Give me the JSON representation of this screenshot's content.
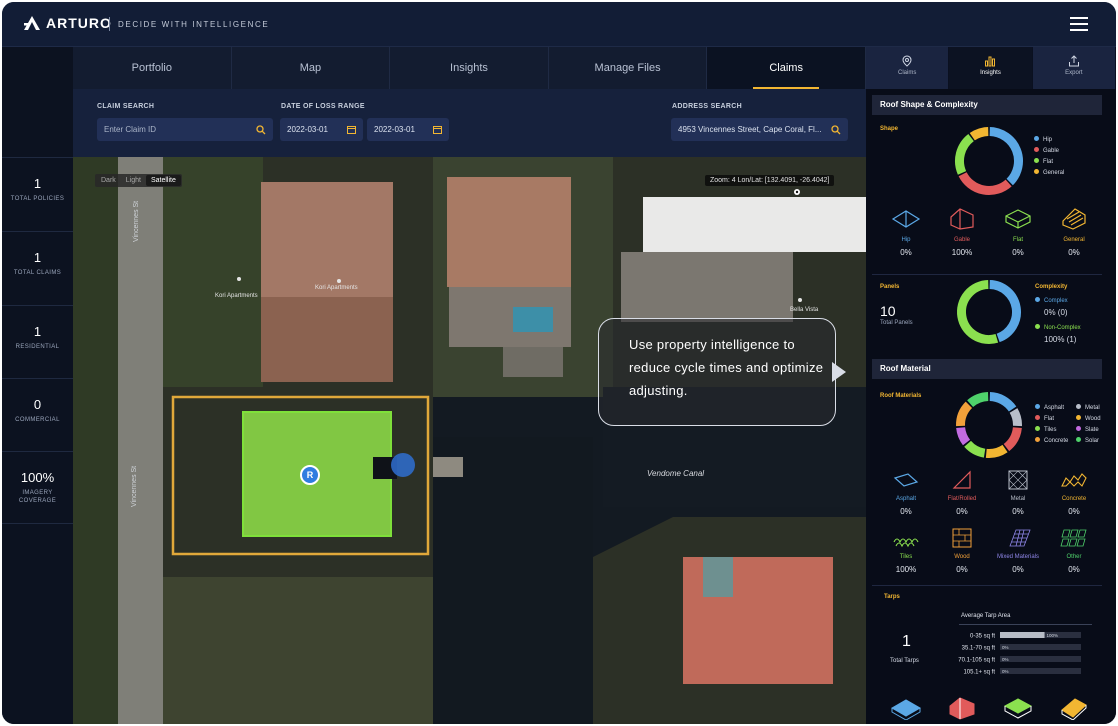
{
  "app": {
    "brand": "ARTURO",
    "tagline": "DECIDE WITH INTELLIGENCE"
  },
  "nav": {
    "tabs": [
      {
        "label": "Portfolio"
      },
      {
        "label": "Map"
      },
      {
        "label": "Insights"
      },
      {
        "label": "Manage Files"
      },
      {
        "label": "Claims",
        "active": true
      }
    ]
  },
  "stats": [
    {
      "value": "1",
      "label": "TOTAL POLICIES"
    },
    {
      "value": "1",
      "label": "TOTAL CLAIMS"
    },
    {
      "value": "1",
      "label": "RESIDENTIAL"
    },
    {
      "value": "0",
      "label": "COMMERCIAL"
    },
    {
      "value": "100%",
      "label": "IMAGERY COVERAGE"
    }
  ],
  "search": {
    "claim_label": "CLAIM SEARCH",
    "claim_placeholder": "Enter Claim ID",
    "date_label": "DATE OF LOSS RANGE",
    "date_from": "2022-03-01",
    "date_to": "2022-03-01",
    "address_label": "ADDRESS SEARCH",
    "address_value": "4953 Vincennes Street, Cape Coral, Fl..."
  },
  "map": {
    "styles": [
      {
        "label": "Dark"
      },
      {
        "label": "Light"
      },
      {
        "label": "Satellite",
        "active": true
      }
    ],
    "zoom_text": "Zoom: 4 Lon/Lat: [132.4091, -26.4042]",
    "callout": "Use property intelligence to reduce cycle times and optimize adjusting.",
    "canal_label": "Vendome Canal",
    "street_label_top": "Vincennes St",
    "street_label_bottom": "Vincennes St",
    "marker_label": "R",
    "pois": [
      {
        "label": "Kori Apartments"
      },
      {
        "label": "Kori Apartments"
      },
      {
        "label": "Bella Vista"
      }
    ]
  },
  "right_tabs": [
    {
      "label": "Claims",
      "icon": "map-pin-icon"
    },
    {
      "label": "Insights",
      "icon": "bar-chart-icon",
      "active": true
    },
    {
      "label": "Export",
      "icon": "export-icon"
    }
  ],
  "roof_shape": {
    "title": "Roof Shape & Complexity",
    "shape_label": "Shape",
    "legend": [
      {
        "label": "Hip",
        "color": "#5ba8e6"
      },
      {
        "label": "Gable",
        "color": "#e15b5b"
      },
      {
        "label": "Flat",
        "color": "#8be04f"
      },
      {
        "label": "General",
        "color": "#f2b632"
      }
    ],
    "donut": [
      {
        "label": "Hip",
        "value": 0.38,
        "color": "#5ba8e6"
      },
      {
        "label": "Gable",
        "value": 0.3,
        "color": "#e15b5b"
      },
      {
        "label": "Flat",
        "value": 0.22,
        "color": "#8be04f"
      },
      {
        "label": "General",
        "value": 0.1,
        "color": "#f2b632"
      }
    ],
    "items": [
      {
        "label": "Hip",
        "value": "0%",
        "color": "#5ba8e6",
        "icon": "hip-roof-icon"
      },
      {
        "label": "Gable",
        "value": "100%",
        "color": "#e15b5b",
        "icon": "gable-roof-icon"
      },
      {
        "label": "Flat",
        "value": "0%",
        "color": "#8be04f",
        "icon": "flat-roof-icon"
      },
      {
        "label": "General",
        "value": "0%",
        "color": "#f2b632",
        "icon": "general-roof-icon"
      }
    ]
  },
  "panels": {
    "label": "Panels",
    "count": "10",
    "count_label": "Total Panels",
    "complexity_label": "Complexity",
    "complex_label": "Complex",
    "complex_value": "0% (0)",
    "complex_color": "#5ba8e6",
    "noncomplex_label": "Non-Complex",
    "noncomplex_value": "100% (1)",
    "noncomplex_color": "#8be04f",
    "donut": [
      {
        "label": "Complex",
        "value": 0.45,
        "color": "#5ba8e6"
      },
      {
        "label": "Non-Complex",
        "value": 0.55,
        "color": "#8be04f"
      }
    ]
  },
  "roof_material": {
    "title": "Roof Material",
    "subtitle": "Roof Materials",
    "legend": [
      {
        "label": "Asphalt",
        "color": "#5ba8e6"
      },
      {
        "label": "Metal",
        "color": "#b8bec9"
      },
      {
        "label": "Flat",
        "color": "#e15b5b"
      },
      {
        "label": "Wood",
        "color": "#f2b632"
      },
      {
        "label": "Tiles",
        "color": "#8be04f"
      },
      {
        "label": "Slate",
        "color": "#c26be0"
      },
      {
        "label": "Concrete",
        "color": "#f2a13a"
      },
      {
        "label": "Solar",
        "color": "#4fd26b"
      }
    ],
    "donut": [
      {
        "label": "Asphalt",
        "value": 0.16,
        "color": "#5ba8e6"
      },
      {
        "label": "Metal",
        "value": 0.1,
        "color": "#b8bec9"
      },
      {
        "label": "Flat",
        "value": 0.14,
        "color": "#e15b5b"
      },
      {
        "label": "Wood",
        "value": 0.12,
        "color": "#f2b632"
      },
      {
        "label": "Tiles",
        "value": 0.12,
        "color": "#8be04f"
      },
      {
        "label": "Slate",
        "value": 0.1,
        "color": "#c26be0"
      },
      {
        "label": "Concrete",
        "value": 0.14,
        "color": "#f2a13a"
      },
      {
        "label": "Solar",
        "value": 0.12,
        "color": "#4fd26b"
      }
    ],
    "items": [
      {
        "label": "Asphalt",
        "value": "0%",
        "color": "#5ba8e6",
        "icon": "asphalt-roof-icon"
      },
      {
        "label": "Flat/Rolled",
        "value": "0%",
        "color": "#e15b5b",
        "icon": "flat-rolled-roof-icon"
      },
      {
        "label": "Metal",
        "value": "0%",
        "color": "#b8bec9",
        "icon": "metal-roof-icon"
      },
      {
        "label": "Concrete",
        "value": "0%",
        "color": "#f2b632",
        "icon": "concrete-roof-icon"
      },
      {
        "label": "Tiles",
        "value": "100%",
        "color": "#8be04f",
        "icon": "tiles-roof-icon"
      },
      {
        "label": "Wood",
        "value": "0%",
        "color": "#f2a13a",
        "icon": "wood-roof-icon"
      },
      {
        "label": "Mixed Materials",
        "value": "0%",
        "color": "#8f86e8",
        "icon": "mixed-materials-roof-icon"
      },
      {
        "label": "Other",
        "value": "0%",
        "color": "#4fd26b",
        "icon": "other-roof-icon"
      }
    ]
  },
  "tarps": {
    "label": "Tarps",
    "count": "1",
    "count_label": "Total Tarps",
    "chart_title": "Average Tarp Area",
    "rows": [
      {
        "range": "0-35 sq ft",
        "pct_text": "100%",
        "value": 0.55
      },
      {
        "range": "35.1-70 sq ft",
        "pct_text": "0%",
        "value": 0.0
      },
      {
        "range": "70.1-105 sq ft",
        "pct_text": "0%",
        "value": 0.0
      },
      {
        "range": "105.1+ sq ft",
        "pct_text": "0%",
        "value": 0.0
      }
    ],
    "bottom_icons": [
      {
        "icon": "hip-roof-icon",
        "color": "#5ba8e6"
      },
      {
        "icon": "gable-roof-icon",
        "color": "#e15b5b"
      },
      {
        "icon": "flat-roof-icon",
        "color": "#8be04f"
      },
      {
        "icon": "general-roof-icon",
        "color": "#f2b632"
      }
    ]
  }
}
